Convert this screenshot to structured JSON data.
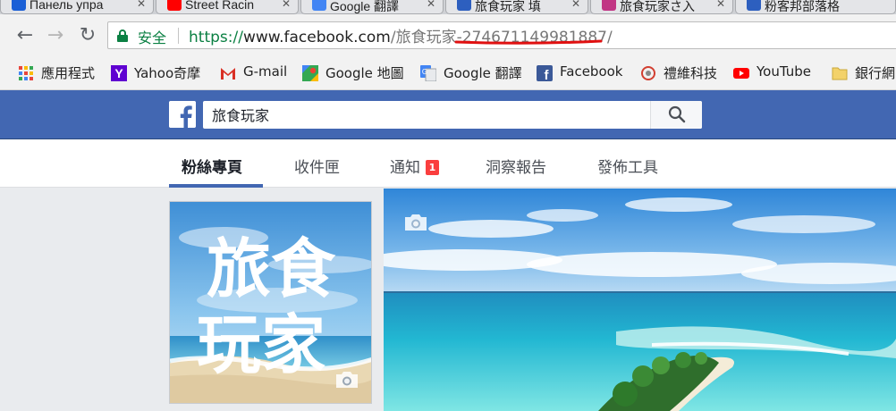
{
  "browser": {
    "tabs": [
      {
        "title": "Панель упра",
        "icon": "square-check-icon",
        "color": "#1a5fd6"
      },
      {
        "title": "Street Racin",
        "icon": "youtube-icon",
        "color": "#ff0000"
      },
      {
        "title": "Google 翻譯",
        "icon": "google-translate-icon",
        "color": "#4285f4"
      },
      {
        "title": "旅食玩家 填",
        "icon": "chat-icon",
        "color": "#2d5fbf"
      },
      {
        "title": "旅食玩家さ入",
        "icon": "instagram-icon",
        "color": "#c13584"
      },
      {
        "title": "粉客邦部落格",
        "icon": "chat-icon",
        "color": "#2d5fbf"
      }
    ],
    "omnibox": {
      "security_label": "安全",
      "url_scheme": "https://",
      "url_host": "www.facebook.com",
      "url_path": "/旅食玩家-274671149981887/"
    },
    "bookmarks": [
      {
        "label": "應用程式",
        "icon": "apps-grid-icon"
      },
      {
        "label": "Yahoo奇摩",
        "icon": "yahoo-icon"
      },
      {
        "label": "G-mail",
        "icon": "gmail-icon"
      },
      {
        "label": "Google 地圖",
        "icon": "google-maps-icon"
      },
      {
        "label": "Google 翻譯",
        "icon": "google-translate-icon"
      },
      {
        "label": "Facebook",
        "icon": "facebook-icon"
      },
      {
        "label": "禮維科技",
        "icon": "company-logo-icon"
      },
      {
        "label": "YouTube",
        "icon": "youtube-icon"
      },
      {
        "label": "銀行網",
        "icon": "folder-icon"
      }
    ]
  },
  "facebook": {
    "search_value": "旅食玩家",
    "nav": [
      {
        "label": "粉絲專頁",
        "active": true
      },
      {
        "label": "收件匣",
        "active": false
      },
      {
        "label": "通知",
        "active": false,
        "badge": "1"
      },
      {
        "label": "洞察報告",
        "active": false
      },
      {
        "label": "發佈工具",
        "active": false
      }
    ],
    "profile_text_line1": "旅食",
    "profile_text_line2": "玩家"
  },
  "colors": {
    "fb_blue": "#4267b2",
    "secure_green": "#0b8043",
    "badge_red": "#fa3e3e",
    "annotation_red": "#e01010"
  }
}
